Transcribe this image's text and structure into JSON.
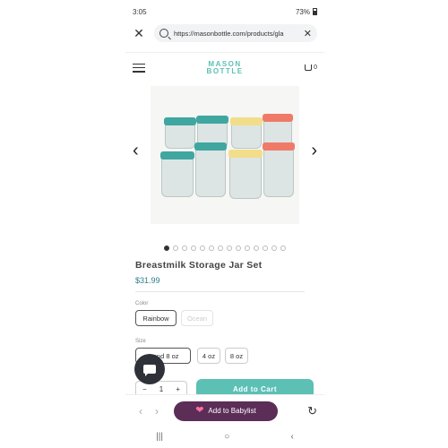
{
  "status": {
    "time": "3:05",
    "battery": "73%"
  },
  "browser": {
    "url": "https://masonbottle.com/products/gla",
    "close": "✕",
    "clear": "✕"
  },
  "site": {
    "logo_line1": "MASON",
    "logo_line2": "BOTTLE",
    "cart_count": "0"
  },
  "gallery": {
    "prev": "‹",
    "next": "›",
    "dots_total": 14,
    "active_dot": 0
  },
  "product": {
    "title": "Breastmilk Storage Jar Set",
    "price": "$31.99"
  },
  "color": {
    "label": "Color",
    "options": [
      "Rainbow",
      "Ocean"
    ]
  },
  "size": {
    "label": "Size",
    "options": [
      "4 and 8 oz",
      "4 oz",
      "8 oz"
    ]
  },
  "quantity": {
    "minus": "−",
    "value": "1",
    "plus": "+"
  },
  "cart_button": "Add to Cart",
  "toolbar": {
    "back": "‹",
    "forward": "›",
    "babylist_label": "Add to Babylist",
    "reload": "↻"
  },
  "sysnav": {
    "recents": "|||",
    "home": "○",
    "back": "‹"
  },
  "colors": {
    "teal": "#5cc0b5",
    "babylist": "#5b2d57",
    "price": "#2c7f8a"
  }
}
